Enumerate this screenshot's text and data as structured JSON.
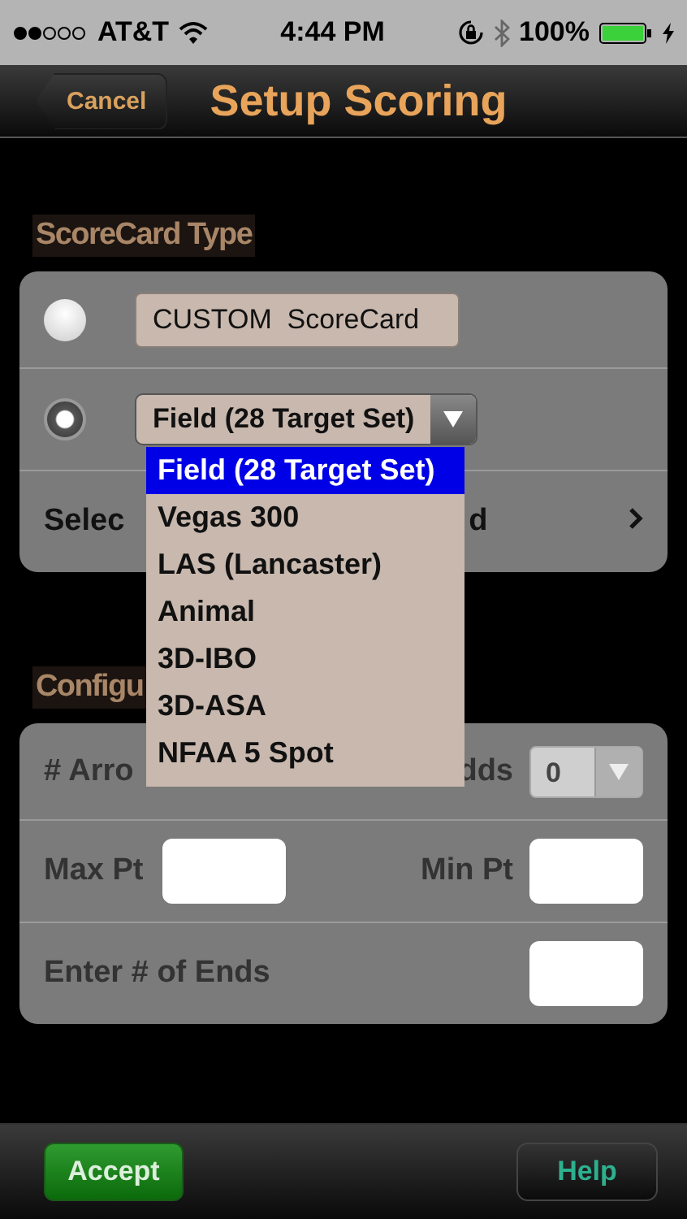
{
  "status_bar": {
    "carrier": "AT&T",
    "time": "4:44 PM",
    "battery": "100%"
  },
  "nav": {
    "back": "Cancel",
    "title": "Setup Scoring"
  },
  "scorecard_type": {
    "header": "ScoreCard Type",
    "options": [
      {
        "kind": "field",
        "selected": false,
        "value": "CUSTOM  ScoreCard"
      },
      {
        "kind": "select",
        "selected": true,
        "value": "Field (28 Target Set)"
      }
    ],
    "link_row": {
      "label": "Selec",
      "label_end": "d"
    }
  },
  "dropdown": {
    "items": [
      {
        "label": "Field (28 Target Set)",
        "selected": true
      },
      {
        "label": "Vegas 300",
        "selected": false
      },
      {
        "label": "LAS (Lancaster)",
        "selected": false
      },
      {
        "label": "Animal",
        "selected": false
      },
      {
        "label": "3D-IBO",
        "selected": false
      },
      {
        "label": "3D-ASA",
        "selected": false
      },
      {
        "label": "NFAA  5 Spot",
        "selected": false
      }
    ]
  },
  "configuration": {
    "header": "Configu",
    "arrows_row": {
      "label": "# Arro",
      "label_end": "dds",
      "value": "0",
      "disabled": true
    },
    "points_row": {
      "max_label": "Max Pt",
      "min_label": "Min Pt"
    },
    "ends_row": {
      "label": "Enter # of Ends"
    }
  },
  "toolbar": {
    "accept": "Accept",
    "help": "Help"
  }
}
